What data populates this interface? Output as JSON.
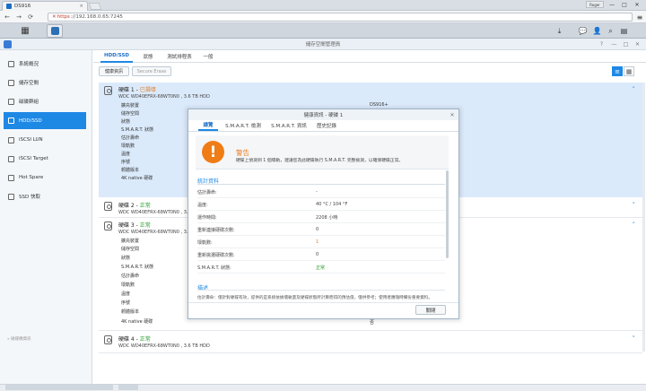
{
  "browser": {
    "tab_title": "DS916",
    "tab_close": "×",
    "user_button": "Roger",
    "win_minimize": "—",
    "win_maximize": "□",
    "win_close": "✕",
    "url_prefix": "✕",
    "url_scheme": "https",
    "url_rest": "://192.168.0.65:7245",
    "back_icon": "←",
    "forward_icon": "→",
    "reload_icon": "⟳",
    "menu_icon": "≡"
  },
  "dsm": {
    "grid_icon": "▦",
    "tray": [
      "⤓",
      "💬",
      "👤",
      "⌕",
      "▤"
    ]
  },
  "app": {
    "title": "儲存空間管理員",
    "ctl": [
      "?",
      "—",
      "□",
      "✕"
    ],
    "sidebar": [
      {
        "label": "系統概況",
        "active": false
      },
      {
        "label": "儲存空間",
        "active": false
      },
      {
        "label": "磁碟群組",
        "active": false
      },
      {
        "label": "HDD/SSD",
        "active": true
      },
      {
        "label": "iSCSI LUN",
        "active": false
      },
      {
        "label": "iSCSI Target",
        "active": false
      },
      {
        "label": "Hot Spare",
        "active": false
      },
      {
        "label": "SSD 快取",
        "active": false
      }
    ],
    "sidebar_bottom": "« 磁碟機資訊",
    "tabs": [
      "HDD/SSD",
      "狀態",
      "測試排程表",
      "一般"
    ],
    "toolbar": {
      "health": "健康資訊",
      "erase": "Secure Erase"
    },
    "view_list": "≡",
    "view_grid": "▦",
    "chevron_up": "˄",
    "chevron_down": "˅"
  },
  "disks": [
    {
      "name": "硬碟 1 - ",
      "status": "已損壞",
      "status_kind": "warn",
      "model": "WDC WD40EFRX-68WT0N0 , 3.6 TB HDD"
    },
    {
      "name": "硬碟 2 - ",
      "status": "正常",
      "status_kind": "ok",
      "model": "WDC WD40EFRX-68WT0N0 , 3.6 TB HDD"
    },
    {
      "name": "硬碟 3 - ",
      "status": "正常",
      "status_kind": "ok",
      "model": "WDC WD40EFRX-68WT0N0 , 3.6 TB HDD"
    },
    {
      "name": "硬碟 4 - ",
      "status": "正常",
      "status_kind": "ok",
      "model": "WDC WD40EFRX-68WT0N0 , 3.6 TB HDD"
    }
  ],
  "disk1_props": [
    "擴充裝置",
    "儲存空間",
    "狀態",
    "S.M.A.R.T. 狀態",
    "估計壽命",
    "壞軌數",
    "溫度",
    "序號",
    "韌體版本",
    "4K native 硬碟"
  ],
  "disk1_device": "DS916+",
  "disk3_props": [
    "擴充裝置",
    "儲存空間",
    "狀態",
    "S.M.A.R.T. 狀態",
    "估計壽命",
    "壞軌數",
    "溫度",
    "序號",
    "韌體版本",
    "4K native 硬碟"
  ],
  "disk3_last": "否",
  "dialog": {
    "title": "健康資訊 - 硬碟 1",
    "close": "✕",
    "tabs": [
      "總覽",
      "S.M.A.R.T. 檢測",
      "S.M.A.R.T. 資訊",
      "歷史記錄"
    ],
    "warn_icon": "!",
    "warn_title": "警告",
    "warn_msg": "硬碟上偵測到 1 個壞軌，建議您為此硬碟執行 S.M.A.R.T. 完整檢測，以確保硬碟正常。",
    "stats_title": "統計資料",
    "stats": [
      {
        "label": "估計壽命:",
        "value": "-",
        "kind": ""
      },
      {
        "label": "溫度:",
        "value": "40 °C / 104 °F",
        "kind": ""
      },
      {
        "label": "運作時間:",
        "value": "2208 小時",
        "kind": ""
      },
      {
        "label": "重新連接硬碟次數:",
        "value": "0",
        "kind": ""
      },
      {
        "label": "壞軌數:",
        "value": "1",
        "kind": "orange"
      },
      {
        "label": "重新挑選硬碟次數:",
        "value": "0",
        "kind": ""
      },
      {
        "label": "S.M.A.R.T. 狀態:",
        "value": "正常",
        "kind": "green"
      }
    ],
    "desc_title": "描述",
    "desc_text": "估計壽命：僅針對硬碟有效，提供的是系統依據壞軌量及硬碟狀態所計算而得的預估值，僅供參考；使用者應隨時備份重要資料。",
    "close_button": "關閉"
  }
}
